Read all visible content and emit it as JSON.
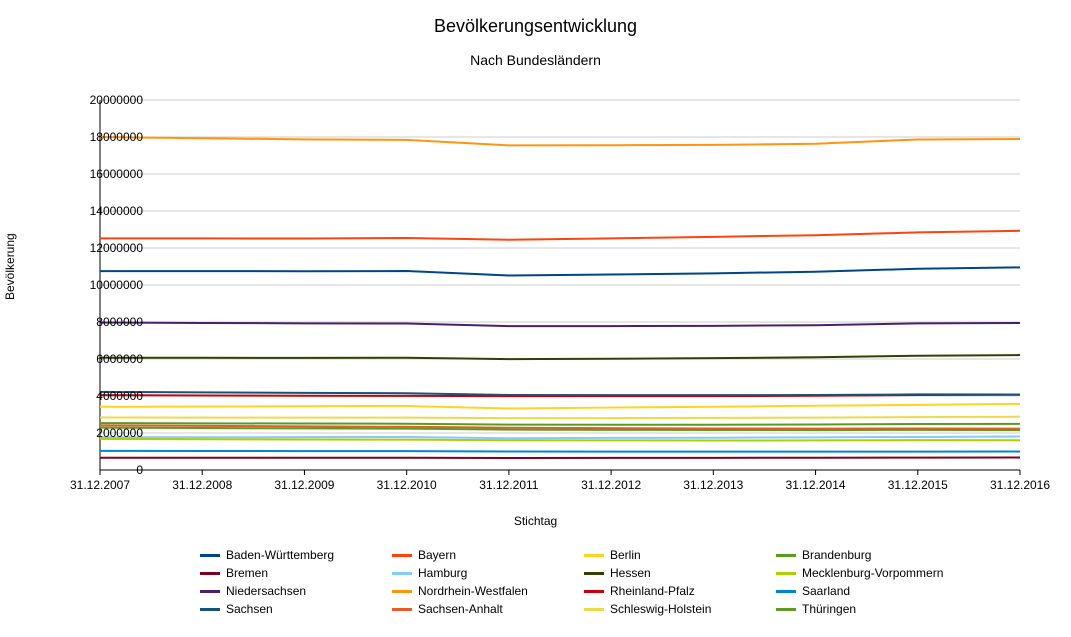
{
  "chart_data": {
    "type": "line",
    "title": "Bevölkerungsentwicklung",
    "subtitle": "Nach Bundesländern",
    "xlabel": "Stichtag",
    "ylabel": "Bevölkerung",
    "ylim": [
      0,
      20000000
    ],
    "yticks": [
      0,
      2000000,
      4000000,
      6000000,
      8000000,
      10000000,
      12000000,
      14000000,
      16000000,
      18000000,
      20000000
    ],
    "categories": [
      "31.12.2007",
      "31.12.2008",
      "31.12.2009",
      "31.12.2010",
      "31.12.2011",
      "31.12.2012",
      "31.12.2013",
      "31.12.2014",
      "31.12.2015",
      "31.12.2016"
    ],
    "series": [
      {
        "name": "Baden-Württemberg",
        "color": "#004586",
        "values": [
          10750000,
          10750000,
          10745000,
          10754000,
          10512000,
          10569000,
          10631000,
          10717000,
          10880000,
          10952000
        ]
      },
      {
        "name": "Bayern",
        "color": "#ff420e",
        "values": [
          12521000,
          12520000,
          12511000,
          12539000,
          12443000,
          12520000,
          12604000,
          12692000,
          12843000,
          12931000
        ]
      },
      {
        "name": "Berlin",
        "color": "#ffd320",
        "values": [
          3416000,
          3432000,
          3443000,
          3461000,
          3326000,
          3375000,
          3422000,
          3470000,
          3520000,
          3575000
        ]
      },
      {
        "name": "Brandenburg",
        "color": "#579d1c",
        "values": [
          2536000,
          2522000,
          2512000,
          2503000,
          2453000,
          2449000,
          2449000,
          2458000,
          2485000,
          2495000
        ]
      },
      {
        "name": "Bremen",
        "color": "#7e0021",
        "values": [
          663000,
          662000,
          661000,
          661000,
          651000,
          654000,
          657000,
          662000,
          671000,
          679000
        ]
      },
      {
        "name": "Hamburg",
        "color": "#83caff",
        "values": [
          1771000,
          1772000,
          1774000,
          1786000,
          1718000,
          1734000,
          1746000,
          1763000,
          1787000,
          1810000
        ]
      },
      {
        "name": "Hessen",
        "color": "#314004",
        "values": [
          6073000,
          6065000,
          6062000,
          6067000,
          5994000,
          6016000,
          6045000,
          6094000,
          6176000,
          6213000
        ]
      },
      {
        "name": "Mecklenburg-Vorpommern",
        "color": "#aecf00",
        "values": [
          1680000,
          1664000,
          1652000,
          1642000,
          1607000,
          1600000,
          1597000,
          1599000,
          1612000,
          1611000
        ]
      },
      {
        "name": "Niedersachsen",
        "color": "#4b1f6f",
        "values": [
          7972000,
          7947000,
          7929000,
          7918000,
          7778000,
          7779000,
          7791000,
          7827000,
          7927000,
          7946000
        ]
      },
      {
        "name": "Nordrhein-Westfalen",
        "color": "#ff950e",
        "values": [
          17997000,
          17933000,
          17873000,
          17845000,
          17545000,
          17554000,
          17572000,
          17638000,
          17865000,
          17890000
        ]
      },
      {
        "name": "Rheinland-Pfalz",
        "color": "#c5000b",
        "values": [
          4046000,
          4028000,
          4013000,
          4004000,
          3990000,
          3990000,
          3994000,
          4012000,
          4053000,
          4066000
        ]
      },
      {
        "name": "Saarland",
        "color": "#0084d1",
        "values": [
          1037000,
          1030000,
          1023000,
          1018000,
          1000000,
          994000,
          991000,
          990000,
          996000,
          997000
        ]
      },
      {
        "name": "Sachsen",
        "color": "#175278",
        "values": [
          4220000,
          4193000,
          4169000,
          4149000,
          4054000,
          4050000,
          4046000,
          4055000,
          4085000,
          4082000
        ]
      },
      {
        "name": "Sachsen-Anhalt",
        "color": "#e85b29",
        "values": [
          2413000,
          2382000,
          2356000,
          2336000,
          2287000,
          2263000,
          2245000,
          2236000,
          2245000,
          2236000
        ]
      },
      {
        "name": "Schleswig-Holstein",
        "color": "#ecd94c",
        "values": [
          2837000,
          2834000,
          2832000,
          2834000,
          2802000,
          2807000,
          2816000,
          2831000,
          2859000,
          2882000
        ]
      },
      {
        "name": "Thüringen",
        "color": "#5e9b24",
        "values": [
          2289000,
          2268000,
          2250000,
          2235000,
          2181000,
          2170000,
          2161000,
          2157000,
          2171000,
          2158000
        ]
      }
    ]
  }
}
